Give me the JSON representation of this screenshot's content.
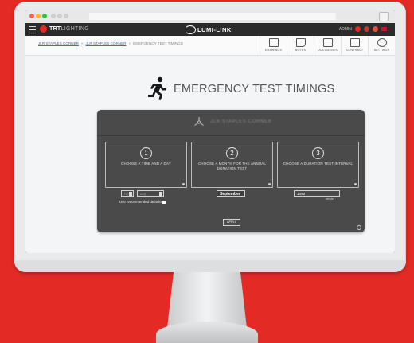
{
  "header": {
    "brand_bold": "TRT",
    "brand_light": "LIGHTING",
    "center_logo": "LUMI-LINK",
    "user": "ADMIN"
  },
  "breadcrumb": {
    "link1": "JLR STAPLES CORNER",
    "link2": "JLR STAPLES CORNER",
    "current": "EMERGENCY TEST TIMINGS",
    "separator": "»"
  },
  "toolbar": {
    "drawings": "DRAWINGS",
    "notes": "NOTES",
    "documents": "DOCUMENTS",
    "contract": "CONTRACT",
    "settings": "SETTINGS"
  },
  "page": {
    "title": "EMERGENCY TEST TIMINGS",
    "site_name": "JLR STAPLES CORNER"
  },
  "steps": [
    {
      "number": "1",
      "text": "CHOOSE A TIME AND A DAY"
    },
    {
      "number": "2",
      "text": "CHOOSE A MONTH FOR THE ANNUAL DURATION TEST"
    },
    {
      "number": "3",
      "text": "CHOOSE A DURATION TEST INTERVAL"
    }
  ],
  "fields": {
    "time_value": "hh",
    "day_value": "Day",
    "use_defaults_label": "Use recommended defaults",
    "month_value": "September",
    "interval_value": "1440",
    "interval_unit": "minutes"
  },
  "apply_label": "APPLY",
  "colors": {
    "background": "#e32a24",
    "panel": "#4a4a4a",
    "header": "#2b2b2b"
  }
}
